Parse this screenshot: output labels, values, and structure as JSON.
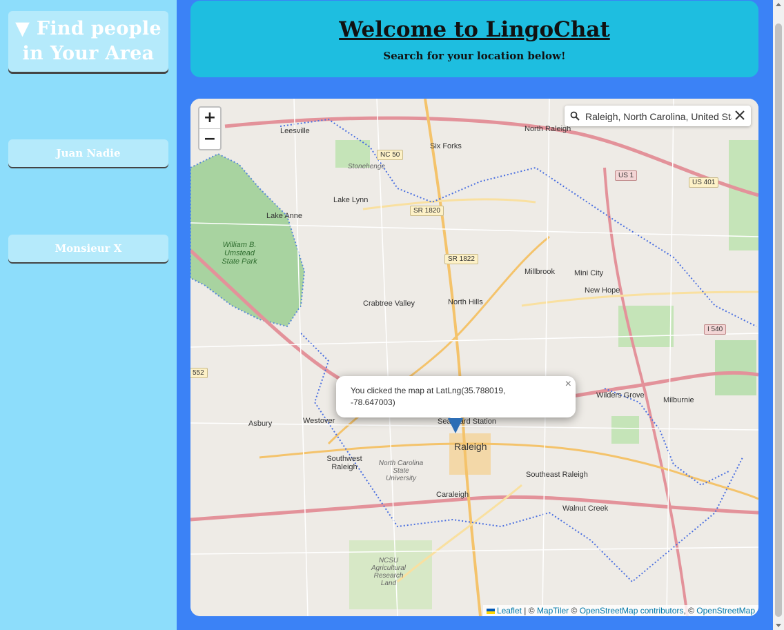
{
  "sidebar": {
    "title_line1": "▼ Find people",
    "title_line2": "in Your Area",
    "users": [
      "Juan Nadie",
      "Monsieur X"
    ]
  },
  "header": {
    "title": "Welcome to LingoChat",
    "subtitle": "Search for your location below!"
  },
  "map": {
    "zoom_in": "+",
    "zoom_out": "−",
    "search_value": "Raleigh, North Carolina, United States",
    "popup_text": "You clicked the map at LatLng(35.788019, -78.647003)",
    "popup_close": "×",
    "labels": {
      "north_raleigh": "North Raleigh",
      "leesville": "Leesville",
      "six_forks": "Six Forks",
      "stonehenge": "Stonehenge",
      "lake_lynn": "Lake Lynn",
      "lake_anne": "Lake Anne",
      "umstead": "William B. Umstead State Park",
      "crabtree": "Crabtree Valley",
      "north_hills": "North Hills",
      "millbrook": "Millbrook",
      "mini_city": "Mini City",
      "new_hope": "New Hope",
      "wilders_grove": "Wilders Grove",
      "milburnie": "Milburnie",
      "westover": "Westover",
      "asbury": "Asbury",
      "seaboard": "Seaboard Station",
      "raleigh": "Raleigh",
      "southwest_raleigh": "Southwest Raleigh",
      "ncsu": "North Carolina State University",
      "southeast_raleigh": "Southeast Raleigh",
      "caraleigh": "Caraleigh",
      "walnut_creek": "Walnut Creek",
      "ncsu_research": "NCSU Agricultural Research Land"
    },
    "shields": {
      "nc50": "NC 50",
      "sr1820": "SR 1820",
      "sr1822": "SR 1822",
      "us1": "US 1",
      "us401": "US 401",
      "i540": "I 540",
      "s552": "552"
    },
    "attribution": {
      "leaflet": "Leaflet",
      "sep1": " | © ",
      "maptiler": "MapTiler",
      "sep2": " © ",
      "osm": "OpenStreetMap contributors",
      "sep3": ", © ",
      "osm2": "OpenStreetMap"
    }
  },
  "colors": {
    "page_bg": "#3b82f6",
    "sidebar_bg": "#8dddfb",
    "sidebar_card": "#b5eafb",
    "header_bg": "#1ebee0"
  }
}
